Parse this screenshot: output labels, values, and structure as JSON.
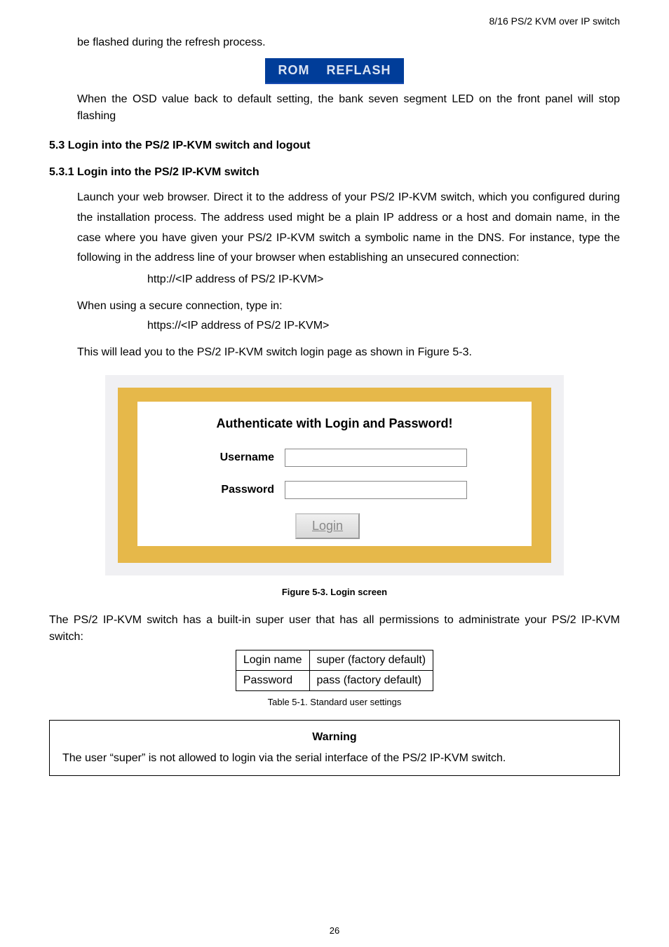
{
  "header": {
    "product": "8/16 PS/2 KVM over IP switch"
  },
  "intro": {
    "line1": "be flashed during the refresh process.",
    "rom_left": "ROM",
    "rom_right": "REFLASH",
    "line2": "When the OSD value back to default setting, the bank seven segment LED on the front panel will stop flashing"
  },
  "section53": {
    "title": "5.3 Login into the PS/2 IP-KVM switch and logout"
  },
  "section531": {
    "title": "5.3.1  Login into the PS/2 IP-KVM switch",
    "p1": "Launch your web browser. Direct it to the address of your PS/2 IP-KVM switch, which you configured during the installation process. The address used might be a plain IP address or a host and domain name, in the case where you have given your PS/2 IP-KVM switch a symbolic name in the DNS. For instance, type the following in the address line of your browser when establishing an unsecured connection:",
    "url1": "http://<IP address of PS/2 IP-KVM>",
    "p2": "When using a secure connection, type in:",
    "url2": "https://<IP address of PS/2 IP-KVM>",
    "p3": "This will lead you to the PS/2 IP-KVM switch login page as shown in Figure 5-3."
  },
  "login_screen": {
    "heading": "Authenticate with Login and Password!",
    "username_label": "Username",
    "password_label": "Password",
    "button": "Login"
  },
  "figure_caption": "Figure 5-3. Login screen",
  "super_user": {
    "intro": "The PS/2 IP-KVM switch has a built-in super user that has all permissions to administrate your PS/2 IP-KVM switch:",
    "rows": [
      {
        "k": "Login name",
        "v": "super (factory default)"
      },
      {
        "k": "Password",
        "v": "pass (factory default)"
      }
    ],
    "table_caption": "Table 5-1. Standard user settings"
  },
  "warning": {
    "title": "Warning",
    "body": "The user “super” is not allowed to login via the serial interface of the PS/2 IP-KVM switch."
  },
  "page_number": "26"
}
